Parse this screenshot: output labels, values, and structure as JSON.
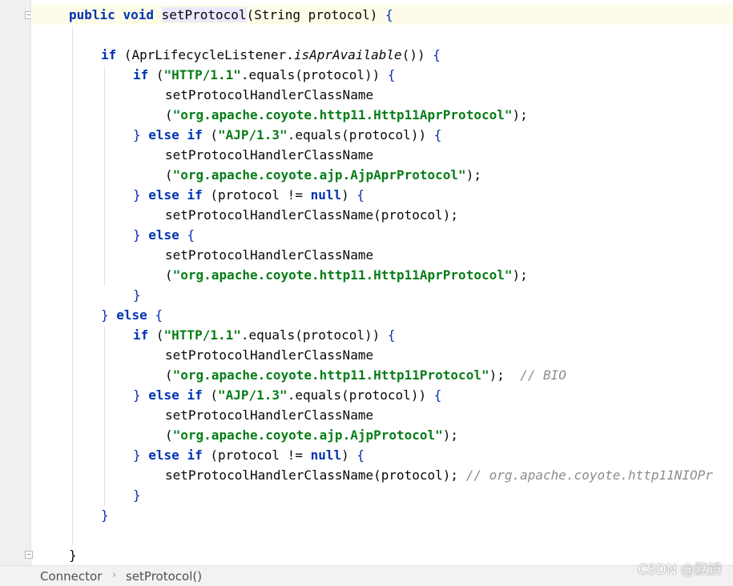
{
  "editor": {
    "lines": [
      [
        {
          "t": "public",
          "c": "kw"
        },
        {
          "t": " "
        },
        {
          "t": "void",
          "c": "kw"
        },
        {
          "t": " "
        },
        {
          "t": "setProtocol",
          "c": "mname"
        },
        {
          "t": "(String protocol) "
        },
        {
          "t": "{",
          "c": "br"
        }
      ],
      [],
      [
        {
          "t": "if",
          "c": "kw"
        },
        {
          "t": " (AprLifecycleListener."
        },
        {
          "t": "isAprAvailable",
          "c": "ital"
        },
        {
          "t": "()) "
        },
        {
          "t": "{",
          "c": "br"
        }
      ],
      [
        {
          "t": "if",
          "c": "kw"
        },
        {
          "t": " ("
        },
        {
          "t": "\"HTTP/1.1\"",
          "c": "str"
        },
        {
          "t": ".equals(protocol)) "
        },
        {
          "t": "{",
          "c": "br"
        }
      ],
      [
        {
          "t": "setProtocolHandlerClassName"
        }
      ],
      [
        {
          "t": "("
        },
        {
          "t": "\"org.apache.coyote.http11.Http11AprProtocol\"",
          "c": "str"
        },
        {
          "t": ");"
        }
      ],
      [
        {
          "t": "}",
          "c": "br"
        },
        {
          "t": " "
        },
        {
          "t": "else",
          "c": "kw"
        },
        {
          "t": " "
        },
        {
          "t": "if",
          "c": "kw"
        },
        {
          "t": " ("
        },
        {
          "t": "\"AJP/1.3\"",
          "c": "str"
        },
        {
          "t": ".equals(protocol)) "
        },
        {
          "t": "{",
          "c": "br"
        }
      ],
      [
        {
          "t": "setProtocolHandlerClassName"
        }
      ],
      [
        {
          "t": "("
        },
        {
          "t": "\"org.apache.coyote.ajp.AjpAprProtocol\"",
          "c": "str"
        },
        {
          "t": ");"
        }
      ],
      [
        {
          "t": "}",
          "c": "br"
        },
        {
          "t": " "
        },
        {
          "t": "else",
          "c": "kw"
        },
        {
          "t": " "
        },
        {
          "t": "if",
          "c": "kw"
        },
        {
          "t": " (protocol != "
        },
        {
          "t": "null",
          "c": "kw"
        },
        {
          "t": ") "
        },
        {
          "t": "{",
          "c": "br"
        }
      ],
      [
        {
          "t": "setProtocolHandlerClassName(protocol);"
        }
      ],
      [
        {
          "t": "}",
          "c": "br"
        },
        {
          "t": " "
        },
        {
          "t": "else",
          "c": "kw"
        },
        {
          "t": " "
        },
        {
          "t": "{",
          "c": "br"
        }
      ],
      [
        {
          "t": "setProtocolHandlerClassName"
        }
      ],
      [
        {
          "t": "("
        },
        {
          "t": "\"org.apache.coyote.http11.Http11AprProtocol\"",
          "c": "str"
        },
        {
          "t": ");"
        }
      ],
      [
        {
          "t": "}",
          "c": "br"
        }
      ],
      [
        {
          "t": "}",
          "c": "br"
        },
        {
          "t": " "
        },
        {
          "t": "else",
          "c": "kw"
        },
        {
          "t": " "
        },
        {
          "t": "{",
          "c": "br"
        }
      ],
      [
        {
          "t": "if",
          "c": "kw"
        },
        {
          "t": " ("
        },
        {
          "t": "\"HTTP/1.1\"",
          "c": "str"
        },
        {
          "t": ".equals(protocol)) "
        },
        {
          "t": "{",
          "c": "br"
        }
      ],
      [
        {
          "t": "setProtocolHandlerClassName"
        }
      ],
      [
        {
          "t": "("
        },
        {
          "t": "\"org.apache.coyote.http11.Http11Protocol\"",
          "c": "str"
        },
        {
          "t": ");  "
        },
        {
          "t": "// BIO",
          "c": "cmt"
        }
      ],
      [
        {
          "t": "}",
          "c": "br"
        },
        {
          "t": " "
        },
        {
          "t": "else",
          "c": "kw"
        },
        {
          "t": " "
        },
        {
          "t": "if",
          "c": "kw"
        },
        {
          "t": " ("
        },
        {
          "t": "\"AJP/1.3\"",
          "c": "str"
        },
        {
          "t": ".equals(protocol)) "
        },
        {
          "t": "{",
          "c": "br"
        }
      ],
      [
        {
          "t": "setProtocolHandlerClassName"
        }
      ],
      [
        {
          "t": "("
        },
        {
          "t": "\"org.apache.coyote.ajp.AjpProtocol\"",
          "c": "str"
        },
        {
          "t": ");"
        }
      ],
      [
        {
          "t": "}",
          "c": "br"
        },
        {
          "t": " "
        },
        {
          "t": "else",
          "c": "kw"
        },
        {
          "t": " "
        },
        {
          "t": "if",
          "c": "kw"
        },
        {
          "t": " (protocol != "
        },
        {
          "t": "null",
          "c": "kw"
        },
        {
          "t": ") "
        },
        {
          "t": "{",
          "c": "br"
        }
      ],
      [
        {
          "t": "setProtocolHandlerClassName(protocol); "
        },
        {
          "t": "// org.apache.coyote.http11NIOPr",
          "c": "cmt"
        }
      ],
      [
        {
          "t": "}",
          "c": "br"
        }
      ],
      [
        {
          "t": "}",
          "c": "br"
        }
      ],
      [],
      [
        {
          "t": "}",
          "c": "id"
        }
      ]
    ]
  },
  "statusbar": {
    "breadcrumb_class": "Connector",
    "breadcrumb_method": "setProtocol()"
  },
  "watermark": "CSDN @默辨",
  "colors": {
    "keyword": "#0033b3",
    "string": "#067d17",
    "comment": "#8c8c8c",
    "line_highlight": "#fdfce9"
  }
}
